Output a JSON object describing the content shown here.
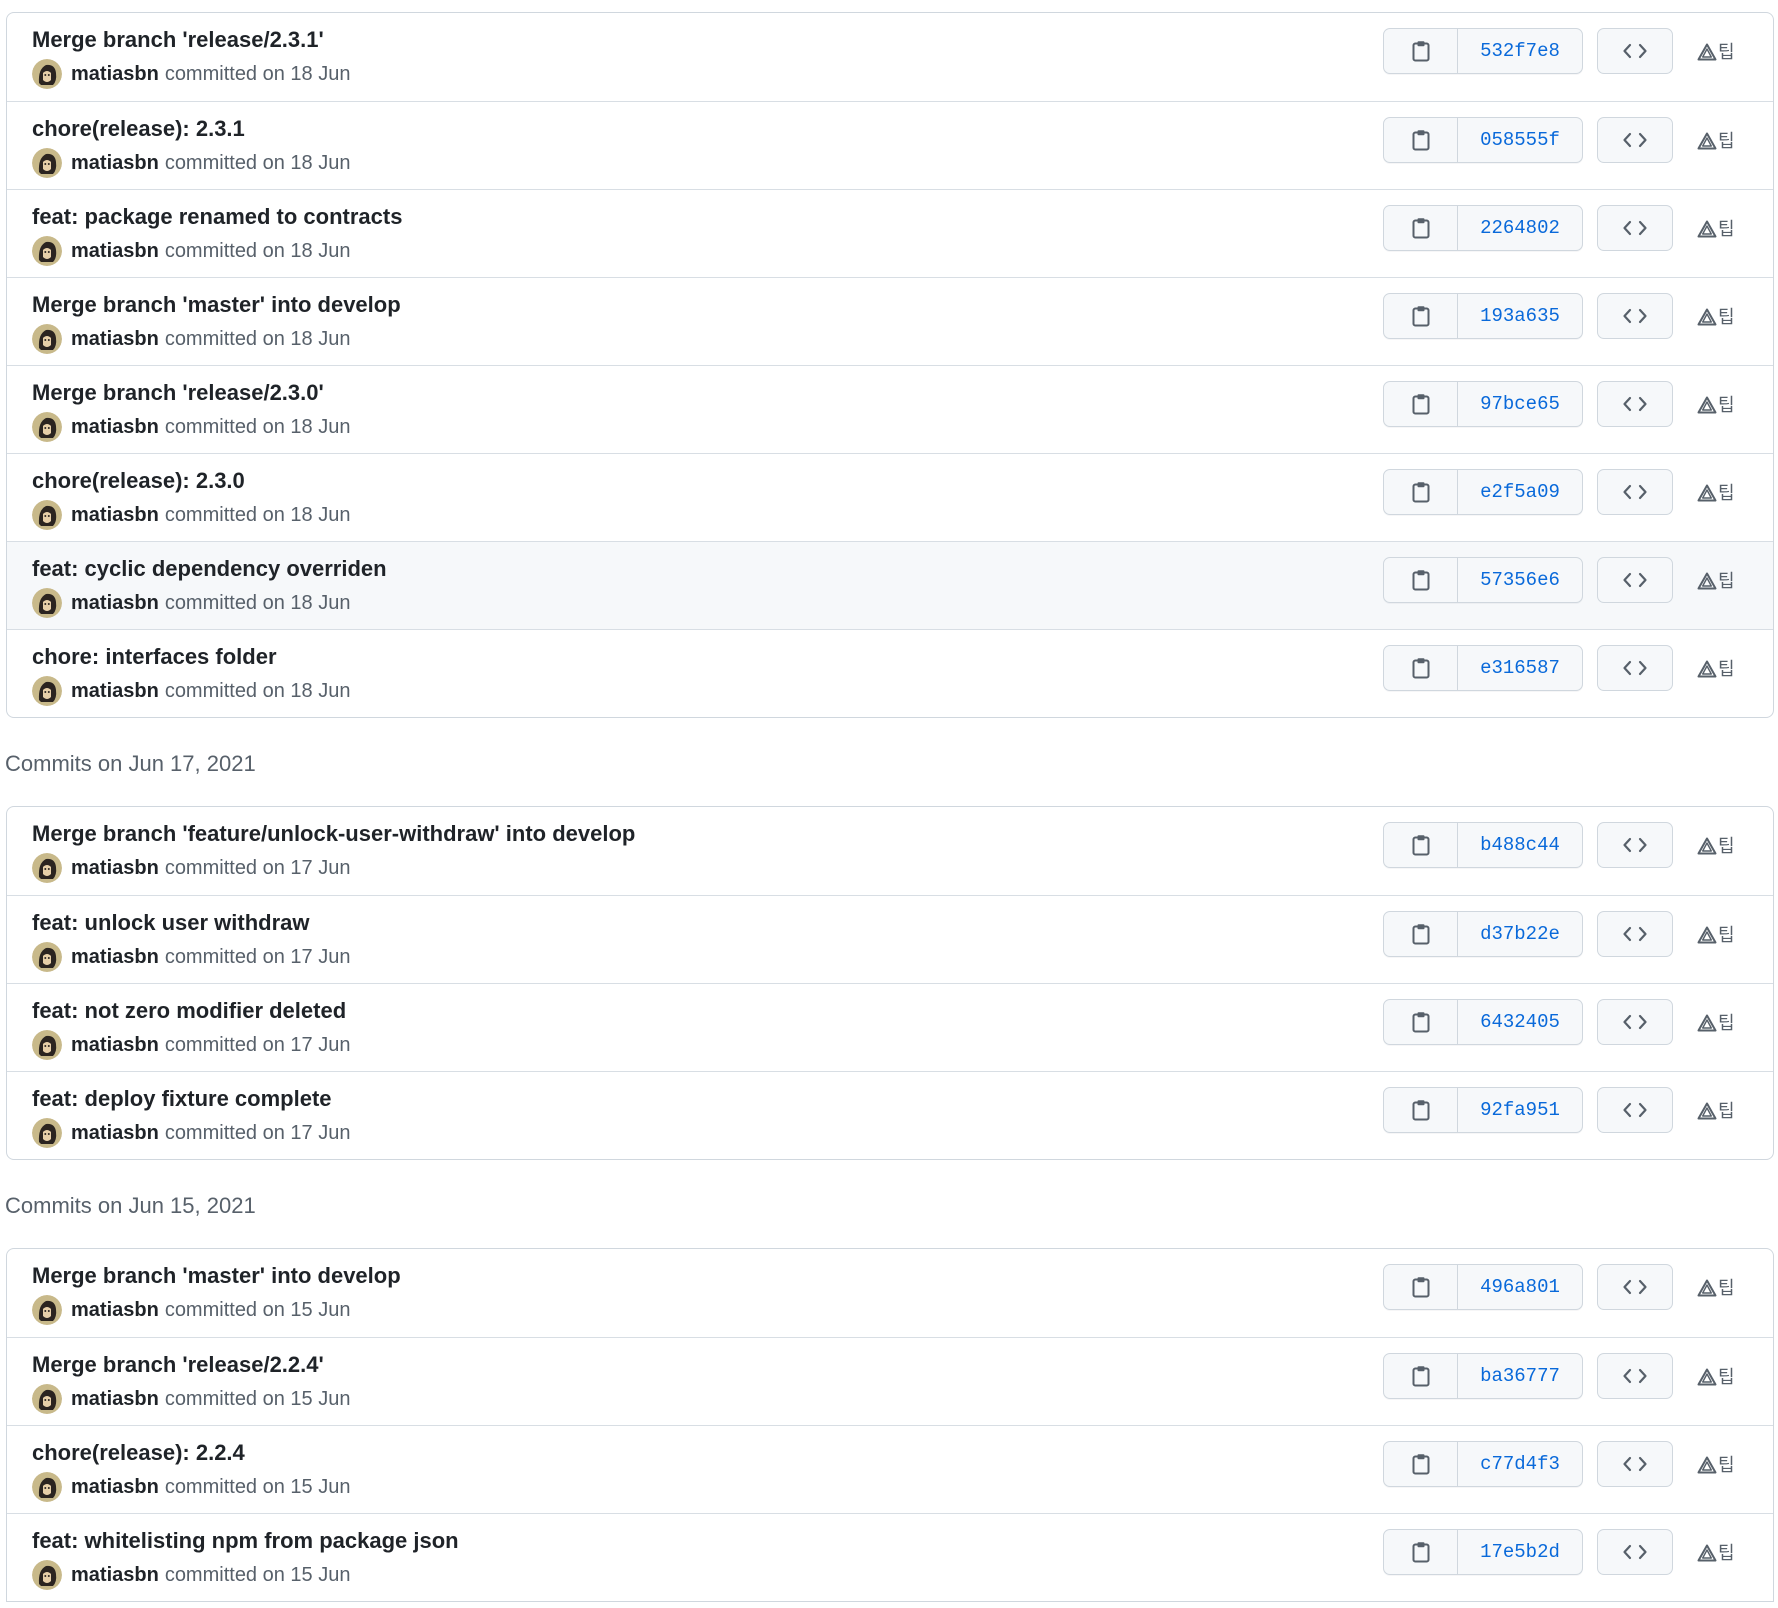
{
  "accent_color": "#0969da",
  "icons": {
    "copy": "clipboard-icon",
    "browse": "code-brackets-icon",
    "extension": "tree-icon",
    "extension_glyph": "팁"
  },
  "groups": [
    {
      "header": "",
      "commits": [
        {
          "title": "Merge branch 'release/2.3.1'",
          "author": "matiasbn",
          "meta": "committed on 18 Jun",
          "sha": "532f7e8"
        },
        {
          "title": "chore(release): 2.3.1",
          "author": "matiasbn",
          "meta": "committed on 18 Jun",
          "sha": "058555f"
        },
        {
          "title": "feat: package renamed to contracts",
          "author": "matiasbn",
          "meta": "committed on 18 Jun",
          "sha": "2264802"
        },
        {
          "title": "Merge branch 'master' into develop",
          "author": "matiasbn",
          "meta": "committed on 18 Jun",
          "sha": "193a635"
        },
        {
          "title": "Merge branch 'release/2.3.0'",
          "author": "matiasbn",
          "meta": "committed on 18 Jun",
          "sha": "97bce65"
        },
        {
          "title": "chore(release): 2.3.0",
          "author": "matiasbn",
          "meta": "committed on 18 Jun",
          "sha": "e2f5a09"
        },
        {
          "title": "feat: cyclic dependency overriden",
          "author": "matiasbn",
          "meta": "committed on 18 Jun",
          "sha": "57356e6",
          "highlight": true
        },
        {
          "title": "chore: interfaces folder",
          "author": "matiasbn",
          "meta": "committed on 18 Jun",
          "sha": "e316587"
        }
      ]
    },
    {
      "header": "Commits on Jun 17, 2021",
      "commits": [
        {
          "title": "Merge branch 'feature/unlock-user-withdraw' into develop",
          "author": "matiasbn",
          "meta": "committed on 17 Jun",
          "sha": "b488c44"
        },
        {
          "title": "feat: unlock user withdraw",
          "author": "matiasbn",
          "meta": "committed on 17 Jun",
          "sha": "d37b22e"
        },
        {
          "title": "feat: not zero modifier deleted",
          "author": "matiasbn",
          "meta": "committed on 17 Jun",
          "sha": "6432405"
        },
        {
          "title": "feat: deploy fixture complete",
          "author": "matiasbn",
          "meta": "committed on 17 Jun",
          "sha": "92fa951"
        }
      ]
    },
    {
      "header": "Commits on Jun 15, 2021",
      "commits": [
        {
          "title": "Merge branch 'master' into develop",
          "author": "matiasbn",
          "meta": "committed on 15 Jun",
          "sha": "496a801"
        },
        {
          "title": "Merge branch 'release/2.2.4'",
          "author": "matiasbn",
          "meta": "committed on 15 Jun",
          "sha": "ba36777"
        },
        {
          "title": "chore(release): 2.2.4",
          "author": "matiasbn",
          "meta": "committed on 15 Jun",
          "sha": "c77d4f3"
        },
        {
          "title": "feat: whitelisting npm from package json",
          "author": "matiasbn",
          "meta": "committed on 15 Jun",
          "sha": "17e5b2d"
        }
      ]
    }
  ]
}
